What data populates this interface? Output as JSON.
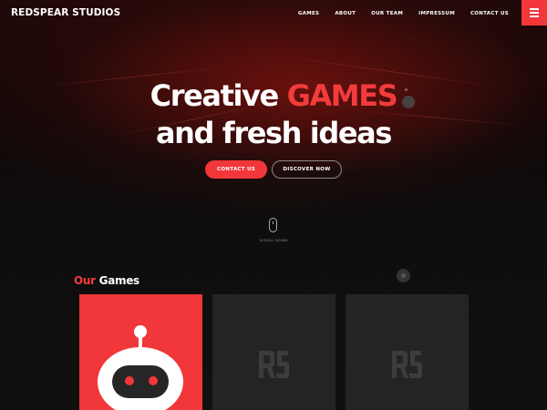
{
  "header": {
    "brand": "REDSPEAR STUDIOS",
    "nav": [
      "GAMES",
      "ABOUT",
      "OUR TEAM",
      "IMPRESSUM",
      "CONTACT US"
    ],
    "menu_icon": "hamburger-icon"
  },
  "hero": {
    "title_part1": "Creative",
    "title_highlight": "GAMES",
    "title_line2": "and fresh ideas",
    "contact_button": "CONTACT US",
    "discover_button": "DISCOVER NOW",
    "scroll_label": "SCROLL DOWN"
  },
  "games": {
    "title_accent": "Our",
    "title_rest": "Games",
    "cards": [
      {
        "icon": "robot-icon"
      },
      {
        "icon": "rs-logo-icon"
      },
      {
        "icon": "rs-logo-icon"
      }
    ]
  },
  "colors": {
    "accent": "#f1373a",
    "card_dark": "#242424",
    "background": "#101010"
  }
}
